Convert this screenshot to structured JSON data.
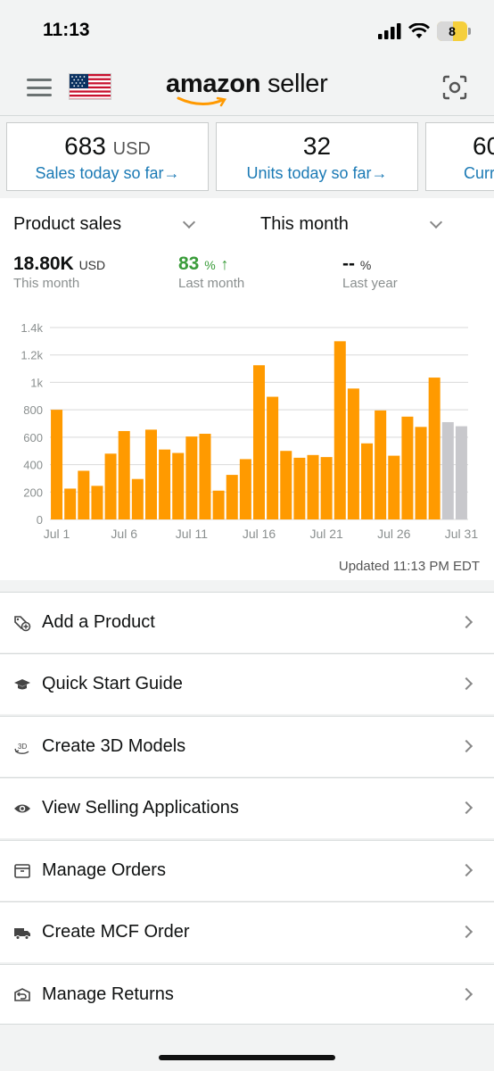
{
  "status_bar": {
    "time": "11:13",
    "battery": "8"
  },
  "header": {
    "logo_amazon": "amazon",
    "logo_seller": "seller"
  },
  "cards": [
    {
      "value": "683",
      "unit": "USD",
      "link": "Sales today so far"
    },
    {
      "value": "32",
      "unit": "",
      "link": "Units today so far"
    },
    {
      "value": "60",
      "unit": "",
      "link": "Curre"
    }
  ],
  "chart_controls": {
    "metric": "Product sales",
    "period": "This month"
  },
  "stats": [
    {
      "value": "18.80K",
      "unit": "USD",
      "label": "This month",
      "color": "#0f1111"
    },
    {
      "value": "83",
      "unit": "%",
      "label": "Last month",
      "color": "#3a9c3a"
    },
    {
      "value": "--",
      "unit": "%",
      "label": "Last year",
      "color": "#0f1111"
    }
  ],
  "chart_data": {
    "type": "bar",
    "categories": [
      "Jul 1",
      "Jul 2",
      "Jul 3",
      "Jul 4",
      "Jul 5",
      "Jul 6",
      "Jul 7",
      "Jul 8",
      "Jul 9",
      "Jul 10",
      "Jul 11",
      "Jul 12",
      "Jul 13",
      "Jul 14",
      "Jul 15",
      "Jul 16",
      "Jul 17",
      "Jul 18",
      "Jul 19",
      "Jul 20",
      "Jul 21",
      "Jul 22",
      "Jul 23",
      "Jul 24",
      "Jul 25",
      "Jul 26",
      "Jul 27",
      "Jul 28",
      "Jul 29",
      "Jul 30",
      "Jul 31"
    ],
    "values": [
      800,
      225,
      355,
      245,
      480,
      645,
      295,
      655,
      510,
      485,
      605,
      625,
      210,
      325,
      440,
      1125,
      895,
      500,
      450,
      470,
      455,
      1300,
      955,
      555,
      795,
      465,
      750,
      675,
      1035,
      710,
      680
    ],
    "projected_from_index": 29,
    "colors": {
      "actual": "#ff9a00",
      "projected": "#c8c8cc"
    },
    "x_tick_labels": [
      "Jul 1",
      "Jul 6",
      "Jul 11",
      "Jul 16",
      "Jul 21",
      "Jul 26",
      "Jul 31"
    ],
    "y_tick_labels": [
      "0",
      "200",
      "400",
      "600",
      "800",
      "1k",
      "1.2k",
      "1.4k"
    ],
    "ylim": [
      0,
      1400
    ],
    "grid": true,
    "xlabel": "",
    "ylabel": "",
    "title": ""
  },
  "updated_text": "Updated 11:13 PM EDT",
  "menu": [
    {
      "label": "Add a Product",
      "icon": "tag-plus-icon"
    },
    {
      "label": "Quick Start Guide",
      "icon": "graduation-cap-icon"
    },
    {
      "label": "Create 3D Models",
      "icon": "3d-rotate-icon"
    },
    {
      "label": "View Selling Applications",
      "icon": "eye-icon"
    },
    {
      "label": "Manage Orders",
      "icon": "box-icon"
    },
    {
      "label": "Create MCF Order",
      "icon": "truck-icon"
    },
    {
      "label": "Manage Returns",
      "icon": "return-box-icon"
    }
  ]
}
